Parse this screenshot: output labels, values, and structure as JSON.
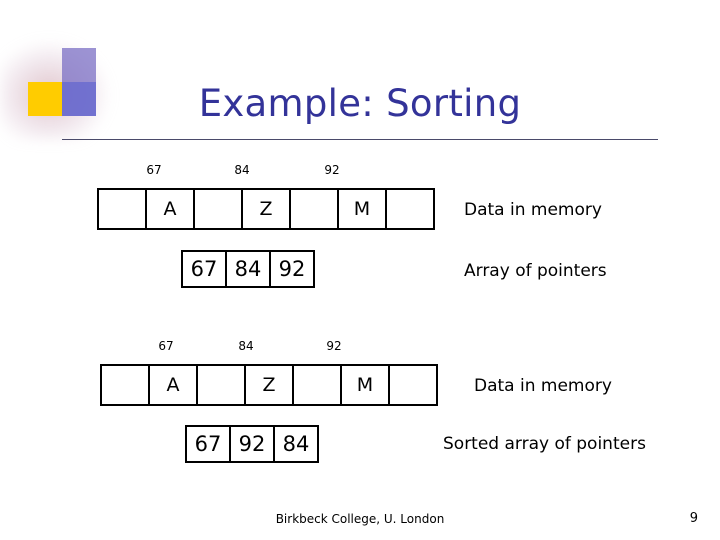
{
  "slide": {
    "title": "Example: Sorting",
    "footer": "Birkbeck College, U. London",
    "page_number": "9",
    "accent_colors": {
      "title": "#333399",
      "square_yellow": "#ffcc00",
      "square_blue": "#6666cc",
      "square_purple": "#7b6fc4"
    }
  },
  "blocks": {
    "memory_top": {
      "addresses": [
        "67",
        "84",
        "92"
      ],
      "cells": [
        "",
        "A",
        "",
        "Z",
        "",
        "M",
        ""
      ],
      "label": "Data in memory"
    },
    "pointers_top": {
      "cells": [
        "67",
        "84",
        "92"
      ],
      "label": "Array of pointers"
    },
    "memory_bottom": {
      "addresses": [
        "67",
        "84",
        "92"
      ],
      "cells": [
        "",
        "A",
        "",
        "Z",
        "",
        "M",
        ""
      ],
      "label": "Data in memory"
    },
    "pointers_bottom": {
      "cells": [
        "67",
        "92",
        "84"
      ],
      "label": "Sorted array of pointers"
    }
  }
}
